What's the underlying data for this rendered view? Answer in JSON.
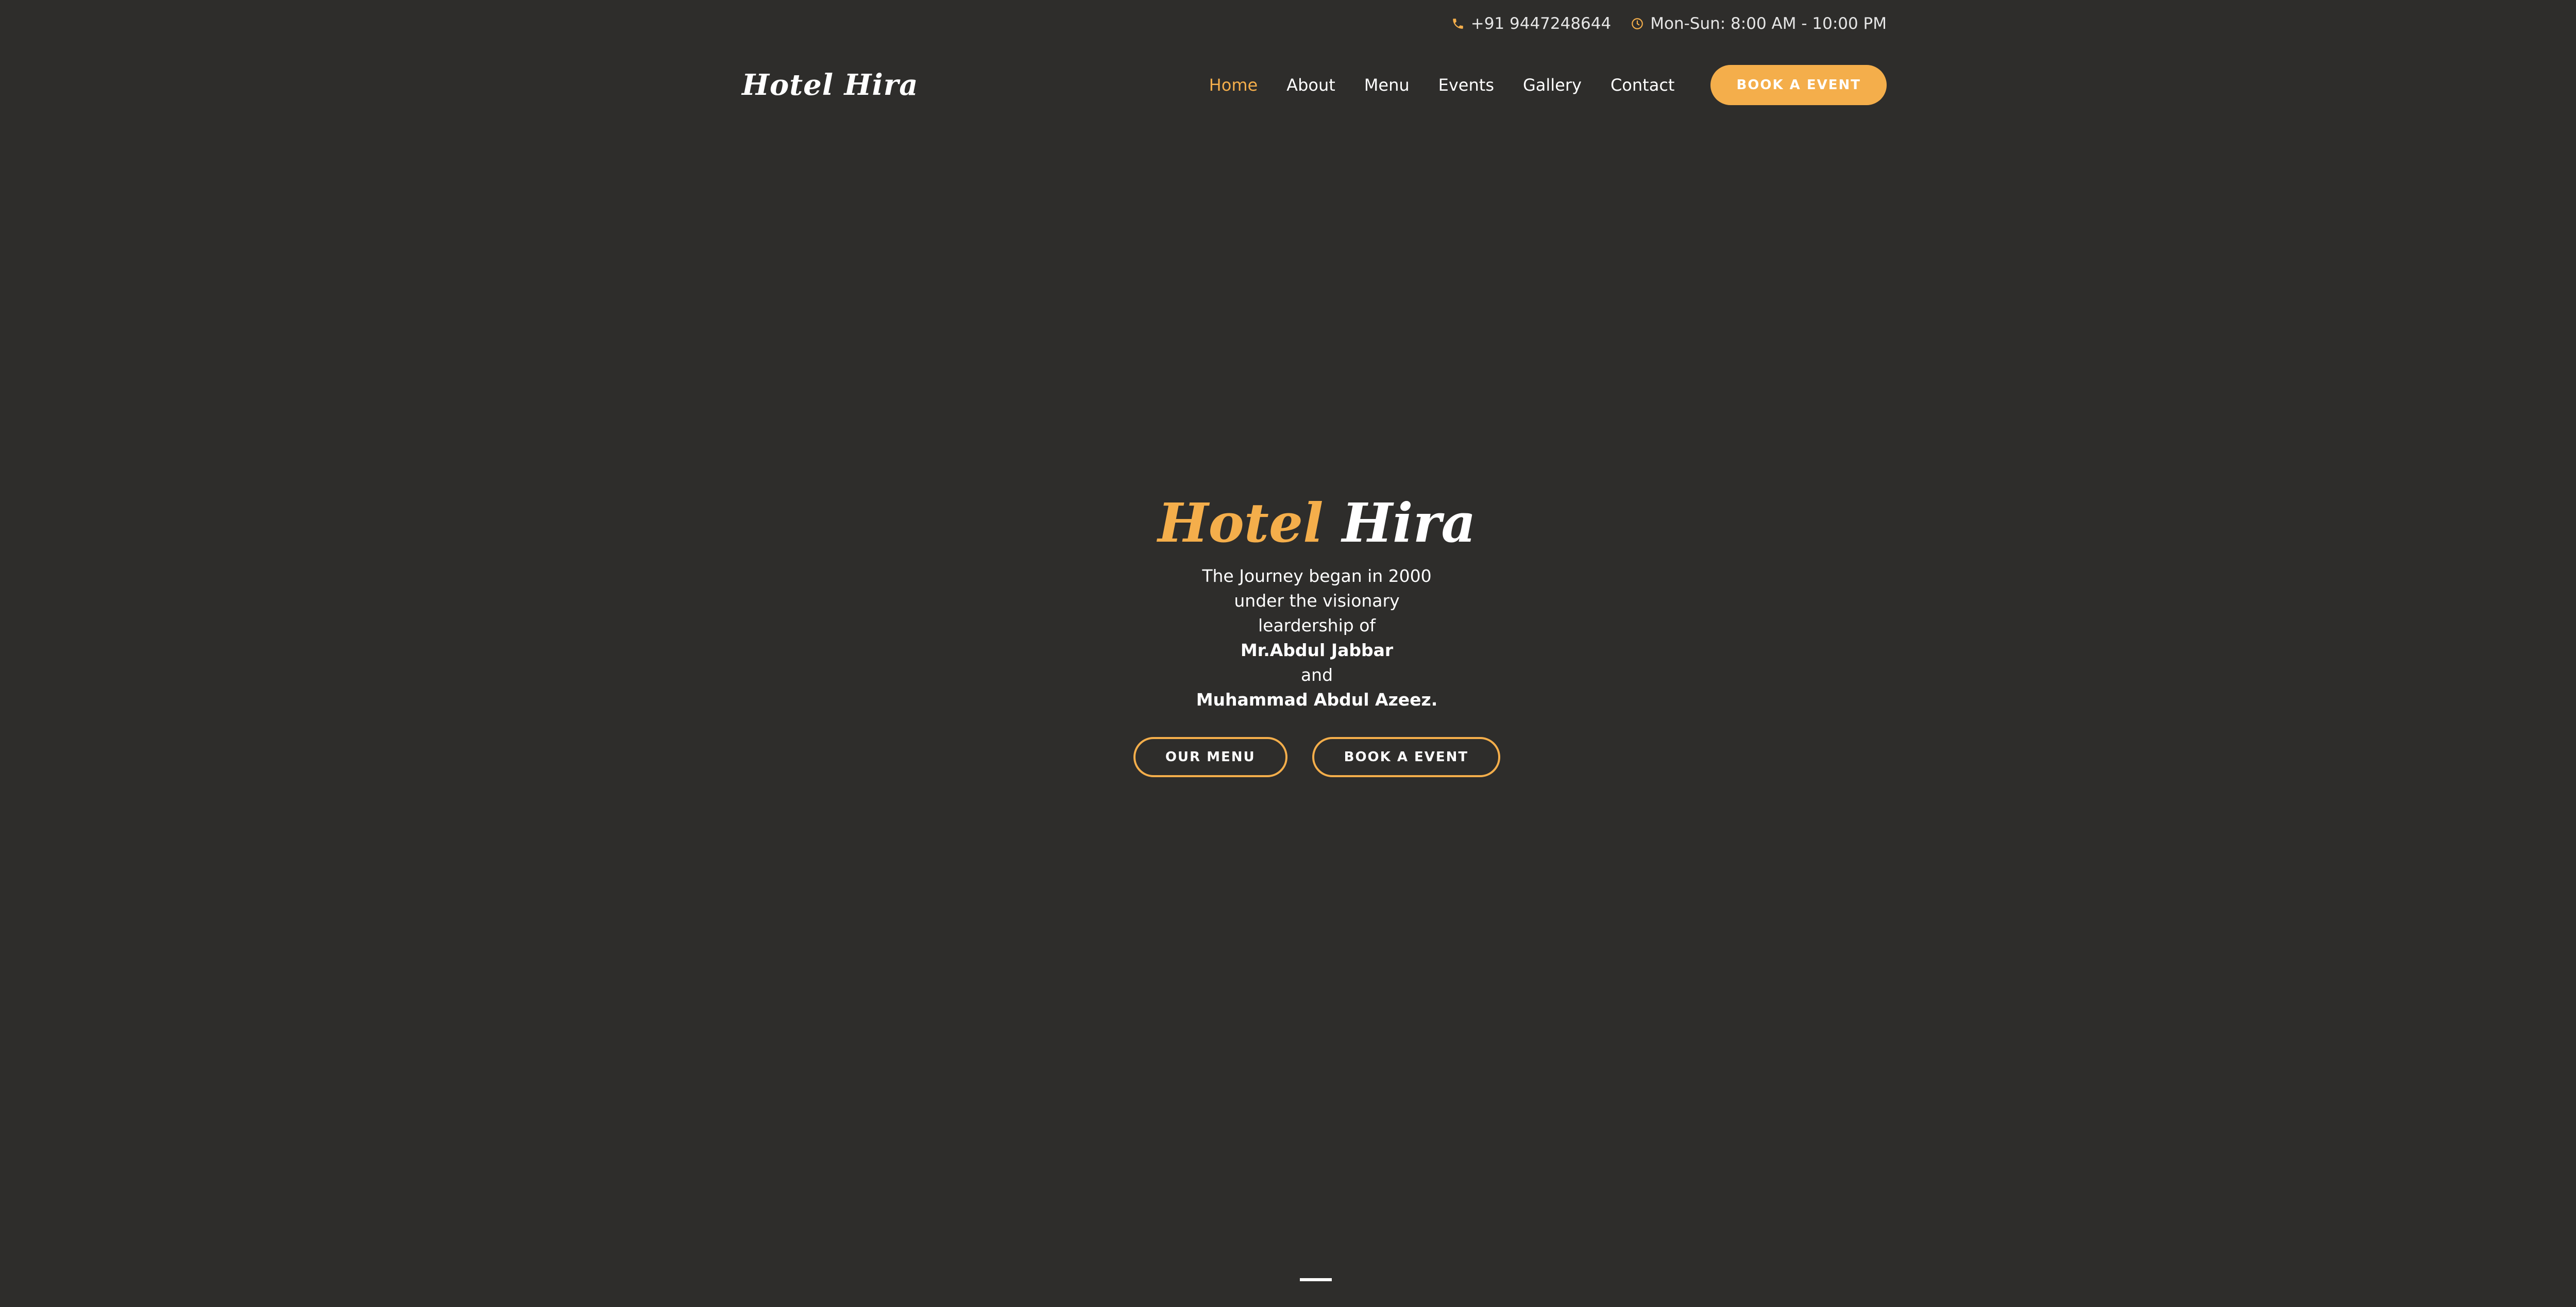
{
  "topbar": {
    "phone": "+91 9447248644",
    "hours": "Mon-Sun: 8:00 AM - 10:00 PM"
  },
  "header": {
    "brand": "Hotel Hira",
    "nav": [
      "Home",
      "About",
      "Menu",
      "Events",
      "Gallery",
      "Contact"
    ],
    "active_nav": "Home",
    "cta_label": "BOOK A EVENT"
  },
  "hero": {
    "title_part1": "Hotel",
    "title_part2": "Hira",
    "lines": [
      "The Journey began in 2000",
      "under the visionary",
      "leardership of",
      "Mr.Abdul Jabbar",
      "and",
      "Muhammad Abdul Azeez."
    ],
    "menu_button": "OUR MENU",
    "event_button": "BOOK A EVENT"
  },
  "colors": {
    "background": "#2e2d2b",
    "accent": "#f4ae4b",
    "text": "#ffffff"
  },
  "icons": {
    "phone": "phone-icon",
    "hours": "clock-icon"
  }
}
